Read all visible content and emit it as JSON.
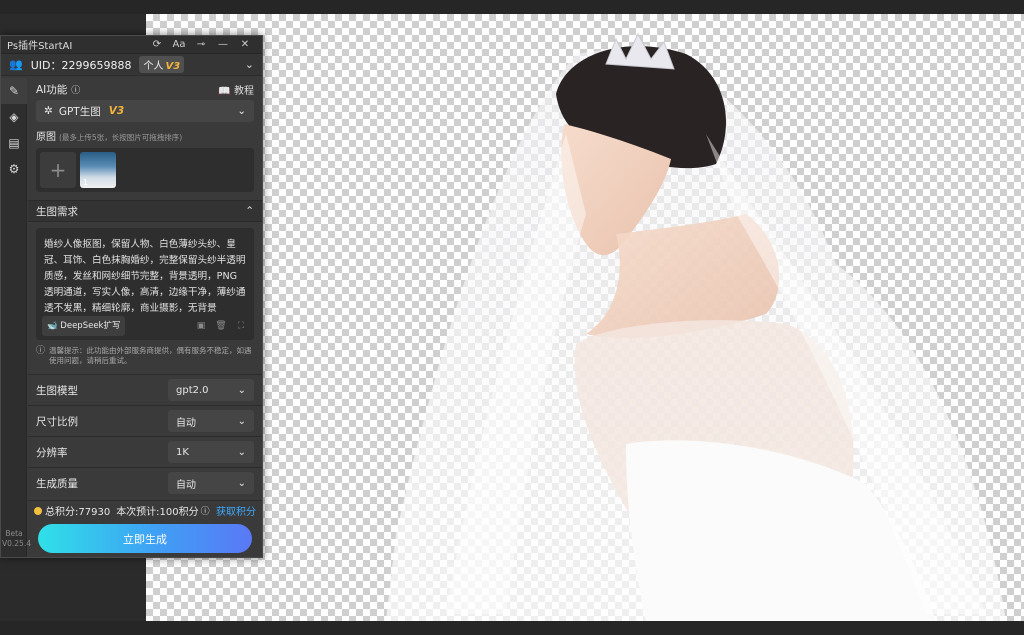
{
  "panel": {
    "title": "Ps插件StartAI",
    "title_icons": [
      "refresh-icon",
      "font-icon",
      "pin-icon",
      "minimize-icon",
      "close-icon"
    ],
    "font_icon_text": "Aa",
    "uid_label": "UID：2299659888",
    "account_badge": "个人",
    "version_badge": "V3"
  },
  "sidebar": {
    "items": [
      "brush-icon",
      "layers-icon",
      "book-icon",
      "gear-icon"
    ],
    "version_line1": "Beta",
    "version_line2": "V0.25.4"
  },
  "ai": {
    "label": "AI功能",
    "tutorial": "教程",
    "function_selected": "GPT生图",
    "function_badge": "V3"
  },
  "source": {
    "label": "原图",
    "hint": "(最多上传5张，长按图片可拖拽排序)",
    "thumb_index": "1"
  },
  "prompt": {
    "section_title": "生图需求",
    "text": "婚纱人像抠图，保留人物、白色薄纱头纱、皇冠、耳饰、白色抹胸婚纱，完整保留头纱半透明质感，发丝和网纱细节完整，背景透明，PNG透明通道，写实人像，高清，边缘干净，薄纱通透不发黑，精细轮廓，商业摄影，无背景",
    "expand_button": "DeepSeek扩写",
    "notice": "温馨提示：此功能由外部服务商提供，偶有服务不稳定，如遇使用问题，请稍后重试。"
  },
  "options": [
    {
      "label": "生图模型",
      "value": "gpt2.0"
    },
    {
      "label": "尺寸比例",
      "value": "自动"
    },
    {
      "label": "分辨率",
      "value": "1K"
    },
    {
      "label": "生成质量",
      "value": "自动"
    }
  ],
  "credits": {
    "total": "总积分:77930",
    "estimate": "本次预计:100积分",
    "get": "获取积分"
  },
  "generate_button": "立即生成",
  "colors": {
    "panel_bg": "#3a3a3a",
    "accent_blue": "#3fa9ff",
    "badge_gold": "#f1b43a",
    "button_gradient_start": "#2fe0e8",
    "button_gradient_end": "#5a78f5"
  }
}
